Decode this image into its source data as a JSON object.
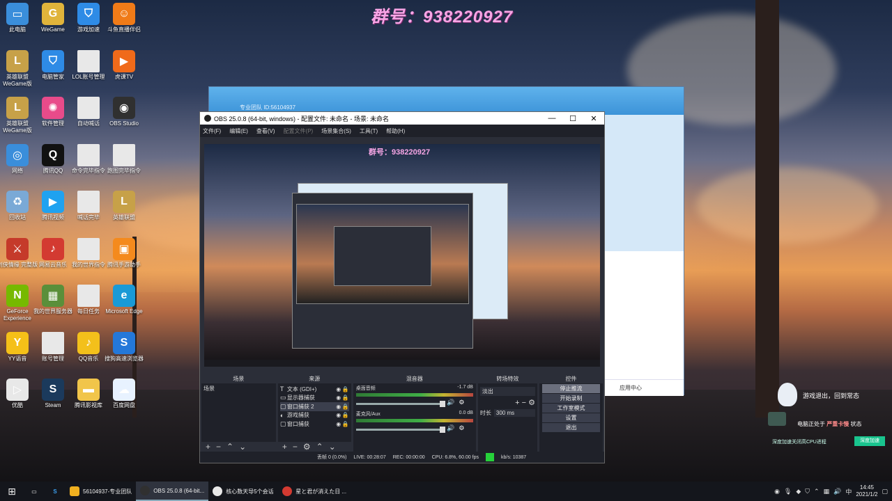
{
  "watermark": "群号：938220927",
  "desktop_icons": [
    {
      "label": "此电脑",
      "icon": "computer-icon",
      "color": "#3a8edb"
    },
    {
      "label": "WeGame",
      "icon": "wegame-icon",
      "color": "#e0b43b"
    },
    {
      "label": "游戏加速",
      "icon": "shield-icon",
      "color": "#2e8be6"
    },
    {
      "label": "斗鱼直播伴侣",
      "icon": "douyu-icon",
      "color": "#f07b18"
    },
    {
      "label": "英雄联盟 WeGame版",
      "icon": "lol-icon",
      "color": "#c7a148"
    },
    {
      "label": "电脑管家",
      "icon": "shield-icon",
      "color": "#2e8be6"
    },
    {
      "label": "LOL账号管理",
      "icon": "file-icon",
      "color": "#e8e8e8"
    },
    {
      "label": "虎课TV",
      "icon": "tv-icon",
      "color": "#f06a1a"
    },
    {
      "label": "英雄联盟 WeGame版",
      "icon": "lol-icon",
      "color": "#c7a148"
    },
    {
      "label": "软件管理",
      "icon": "pinwheel-icon",
      "color": "#e84b8a"
    },
    {
      "label": "自动喊话",
      "icon": "file-icon",
      "color": "#e8e8e8"
    },
    {
      "label": "OBS Studio",
      "icon": "obs-icon",
      "color": "#303030"
    },
    {
      "label": "网络",
      "icon": "network-icon",
      "color": "#3a8edb"
    },
    {
      "label": "腾讯QQ",
      "icon": "qq-icon",
      "color": "#111111"
    },
    {
      "label": "命令完毕指令",
      "icon": "file-icon",
      "color": "#e8e8e8"
    },
    {
      "label": "跑图完毕指令",
      "icon": "file-icon",
      "color": "#e8e8e8"
    },
    {
      "label": "回收站",
      "icon": "recycle-icon",
      "color": "#7aa9d6"
    },
    {
      "label": "腾讯视频",
      "icon": "video-icon",
      "color": "#1fa2f0"
    },
    {
      "label": "喊话完毕",
      "icon": "file-icon",
      "color": "#e8e8e8"
    },
    {
      "label": "英雄联盟",
      "icon": "lol-icon",
      "color": "#c7a148"
    },
    {
      "label": "剑侠情缘 完整版",
      "icon": "game-icon",
      "color": "#c53a2a"
    },
    {
      "label": "网易云音乐",
      "icon": "music-icon",
      "color": "#d33a31"
    },
    {
      "label": "我的世界指令",
      "icon": "file-icon",
      "color": "#e8e8e8"
    },
    {
      "label": "腾讯手游助手",
      "icon": "mobile-game-icon",
      "color": "#f48a1d"
    },
    {
      "label": "GeForce Experience",
      "icon": "nvidia-icon",
      "color": "#76b900"
    },
    {
      "label": "我的世界服务器",
      "icon": "minecraft-icon",
      "color": "#5a8f3a"
    },
    {
      "label": "每日任务",
      "icon": "file-icon",
      "color": "#e8e8e8"
    },
    {
      "label": "Microsoft Edge",
      "icon": "edge-icon",
      "color": "#1a9ad6"
    },
    {
      "label": "YY语音",
      "icon": "yy-icon",
      "color": "#f5c018"
    },
    {
      "label": "账号管理",
      "icon": "file-icon",
      "color": "#e8e8e8"
    },
    {
      "label": "QQ音乐",
      "icon": "music-icon",
      "color": "#f3c01b"
    },
    {
      "label": "搜狗高速浏览器",
      "icon": "sogou-icon",
      "color": "#2478d9"
    },
    {
      "label": "优酷",
      "icon": "youku-icon",
      "color": "#e8e8e8"
    },
    {
      "label": "Steam",
      "icon": "steam-icon",
      "color": "#1b3a5c"
    },
    {
      "label": "腾讯影视库",
      "icon": "folder-icon",
      "color": "#f1c54a"
    },
    {
      "label": "百度网盘",
      "icon": "cloud-icon",
      "color": "#e8f2ff"
    }
  ],
  "back_window": {
    "title": "专业团队  ID:56104937",
    "footer": "应用中心"
  },
  "obs": {
    "title": "OBS 25.0.8 (64-bit, windows) - 配置文件: 未命名 - 场景: 未命名",
    "menu": [
      "文件(F)",
      "编辑(E)",
      "查看(V)",
      "配置文件(P)",
      "场景集合(S)",
      "工具(T)",
      "帮助(H)"
    ],
    "preview_watermark": "群号：938220927",
    "docks": {
      "scenes": {
        "title": "场景",
        "items": [
          "场景"
        ]
      },
      "sources": {
        "title": "来源",
        "items": [
          {
            "icon": "text-icon",
            "name": "文本 (GDI+)"
          },
          {
            "icon": "monitor-icon",
            "name": "显示器捕获"
          },
          {
            "icon": "window-icon",
            "name": "窗口捕获 2"
          },
          {
            "icon": "gamepad-icon",
            "name": "游戏捕获"
          },
          {
            "icon": "window-icon",
            "name": "窗口捕获"
          }
        ]
      },
      "mixer": {
        "title": "混音器",
        "tracks": [
          {
            "name": "桌面音频",
            "level": "-1.7 dB"
          },
          {
            "name": "麦克风/Aux",
            "level": "0.0 dB"
          }
        ]
      },
      "transitions": {
        "title": "转场特效",
        "type": "淡出",
        "duration_label": "时长",
        "duration": "300 ms"
      },
      "controls": {
        "title": "控件",
        "buttons": [
          "停止推流",
          "开始录制",
          "工作室模式",
          "设置",
          "退出"
        ]
      }
    },
    "status": {
      "dropped": "丢帧 0 (0.0%)",
      "live": "LIVE: 00:28:07",
      "rec": "REC: 00:00:00",
      "cpu": "CPU: 6.8%, 60.00 fps",
      "bitrate": "kb/s: 10387"
    }
  },
  "notification": {
    "line1": "游戏退出，回到常态",
    "line2_prefix": "电脑正处于",
    "line2_highlight": "严重卡慢",
    "line2_suffix": "状态",
    "line3": "深度加速关闭高CPU进程",
    "button": "深度加速"
  },
  "taskbar": {
    "apps": [
      {
        "label": "56104937-专业团队",
        "color": "#f0b020"
      },
      {
        "label": "OBS 25.0.8 (64-bit...",
        "color": "#303030"
      },
      {
        "label": "核心数天导5个会话",
        "color": "#e8e8e8"
      },
      {
        "label": "星と君が消えた日 ...",
        "color": "#d33a31"
      }
    ],
    "time": "14:45",
    "date": "2021/1/2"
  }
}
